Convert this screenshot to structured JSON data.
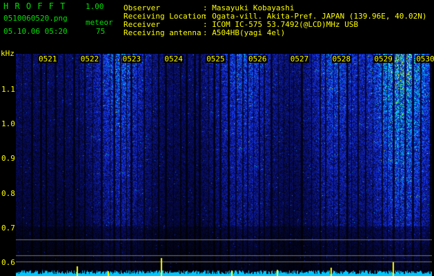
{
  "app": {
    "name": "H R O F F T",
    "version": "1.00"
  },
  "file": {
    "name": "0510060520.png",
    "datetime": "05.10.06 05:20"
  },
  "counter": {
    "label": "meteor",
    "value": "75"
  },
  "info": {
    "labels": [
      "Observer",
      "Receiving Location",
      "Receiver",
      "Receiving antenna"
    ],
    "values": [
      ": Masayuki Kobayashi",
      ": Ogata-vill. Akita-Pref. JAPAN (139.96E, 40.02N)",
      ": ICOM IC-575 53.7492(@LCD)MHz USB",
      ": A504HB(yagi 4el)"
    ]
  },
  "spectrogram": {
    "y_unit": "kHz",
    "y_ticks": [
      "1.1",
      "1.0",
      "0.9",
      "0.8",
      "0.7",
      "0.6"
    ],
    "y_range": [
      0.56,
      1.16
    ],
    "time_marks": [
      "0521",
      "0522",
      "0523",
      "0524",
      "0525",
      "0526",
      "0527",
      "0528",
      "0529",
      "0530"
    ],
    "colors": {
      "bg": "#000000",
      "label": "#ffff00",
      "text": "#00e000",
      "noise": "#1a3cff",
      "signal": "#00ffff",
      "peak": "#ffff00"
    }
  }
}
